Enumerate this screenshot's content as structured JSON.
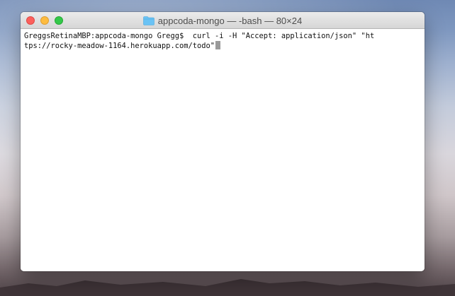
{
  "window": {
    "title": "appcoda-mongo — -bash — 80×24",
    "folder_icon": "folder-icon",
    "controls": [
      "close",
      "minimize",
      "zoom"
    ]
  },
  "terminal": {
    "lines": [
      "GreggsRetinaMBP:appcoda-mongo Gregg$  curl -i -H \"Accept: application/json\" \"ht",
      "tps://rocky-meadow-1164.herokuapp.com/todo\""
    ],
    "cursor": "block-cursor"
  },
  "colors": {
    "close": "#fc605c",
    "minimize": "#fdbc40",
    "zoom": "#34c84a",
    "folder": "#6ac3f5"
  }
}
